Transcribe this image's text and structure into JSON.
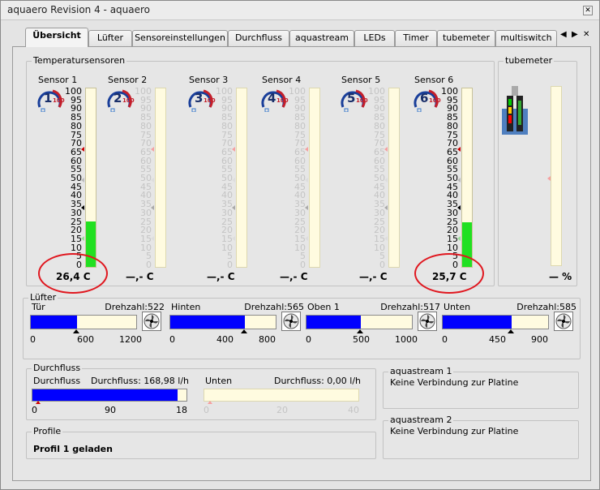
{
  "window": {
    "title": "aquaero Revision 4 -  aquaero",
    "close_label": "✕"
  },
  "tabs": [
    "Übersicht",
    "Lüfter",
    "Sensoreinstellungen",
    "Durchfluss",
    "aquastream",
    "LEDs",
    "Timer",
    "tubemeter",
    "multiswitch"
  ],
  "tabnav": {
    "left": "◀",
    "right": "▶",
    "close": "✕"
  },
  "temperature": {
    "group_label": "Temperatursensoren",
    "scale": [
      "100",
      "95",
      "90",
      "85",
      "80",
      "75",
      "70",
      "65",
      "60",
      "55",
      "50",
      "45",
      "40",
      "35",
      "30",
      "25",
      "20",
      "15",
      "10",
      "5",
      "0"
    ],
    "sensors": [
      {
        "name": "Sensor 1",
        "num": "1",
        "reading": "26,4 C",
        "level": 0.264,
        "active": true
      },
      {
        "name": "Sensor 2",
        "num": "2",
        "reading": "—,- C",
        "level": 0,
        "active": false
      },
      {
        "name": "Sensor 3",
        "num": "3",
        "reading": "—,- C",
        "level": 0,
        "active": false
      },
      {
        "name": "Sensor 4",
        "num": "4",
        "reading": "—,- C",
        "level": 0,
        "active": false
      },
      {
        "name": "Sensor 5",
        "num": "5",
        "reading": "—,- C",
        "level": 0,
        "active": false
      },
      {
        "name": "Sensor 6",
        "num": "6",
        "reading": "25,7 C",
        "level": 0.257,
        "active": true
      }
    ],
    "gauge_max": "100"
  },
  "tubemeter": {
    "label": "tubemeter",
    "reading": "— %"
  },
  "fans": {
    "group_label": "Lüfter",
    "items": [
      {
        "name": "Tür",
        "rpm": "Drehzahl:522",
        "level": 0.435,
        "ticks": [
          "0",
          "600",
          "1200"
        ]
      },
      {
        "name": "Hinten",
        "rpm": "Drehzahl:565",
        "level": 0.706,
        "ticks": [
          "0",
          "400",
          "800"
        ]
      },
      {
        "name": "Oben 1",
        "rpm": "Drehzahl:517",
        "level": 0.517,
        "ticks": [
          "0",
          "500",
          "1000"
        ]
      },
      {
        "name": "Unten",
        "rpm": "Drehzahl:585",
        "level": 0.65,
        "ticks": [
          "0",
          "450",
          "900"
        ]
      }
    ]
  },
  "flow": {
    "group_label": "Durchfluss",
    "items": [
      {
        "name": "Durchfluss",
        "value": "Durchfluss: 168,98 l/h",
        "level": 0.94,
        "ticks": [
          "0",
          "90",
          "18"
        ]
      },
      {
        "name": "Unten",
        "value": "Durchfluss: 0,00 l/h",
        "level": 0,
        "ticks": [
          "0",
          "20",
          "40"
        ]
      }
    ]
  },
  "aquastream": [
    {
      "label": "aquastream 1",
      "status": "Keine Verbindung zur Platine"
    },
    {
      "label": "aquastream 2",
      "status": "Keine Verbindung zur Platine"
    }
  ],
  "profile": {
    "label": "Profile",
    "status": "Profil 1 geladen"
  },
  "colors": {
    "fill_green": "#21e021",
    "fan_blue": "#0000ff",
    "annotation_red": "#e0171f"
  }
}
